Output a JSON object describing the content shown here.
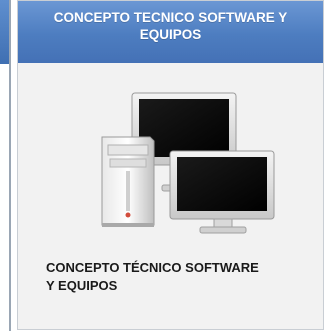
{
  "card": {
    "header_title": "CONCEPTO TECNICO SOFTWARE Y\nEQUIPOS",
    "image_icon": "computer-equipment-icon",
    "caption": "CONCEPTO TÉCNICO SOFTWARE\nY EQUIPOS"
  },
  "colors": {
    "header_top": "#6b97d4",
    "header_bottom": "#4471b6",
    "card_background": "#f2f2f2",
    "caption_text": "#1a1a1a"
  }
}
